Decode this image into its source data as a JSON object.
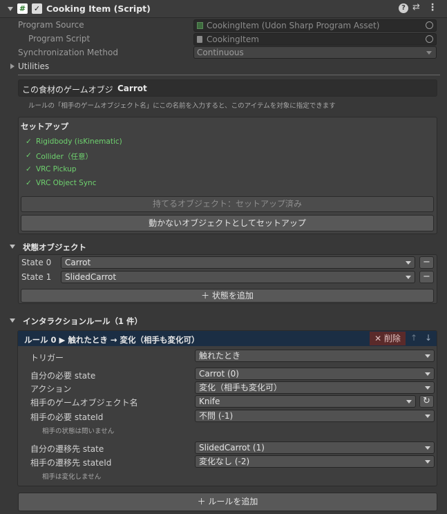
{
  "header": {
    "title": "Cooking Item (Script)",
    "script_icon": "#",
    "help_icon": "?",
    "settings_icon": "⇄",
    "more_icon": "⋮"
  },
  "props": {
    "program_source_label": "Program Source",
    "program_source_value": "CookingItem (Udon Sharp Program Asset)",
    "program_script_label": "Program Script",
    "program_script_value": "CookingItem",
    "sync_label": "Synchronization Method",
    "sync_value": "Continuous",
    "utilities_label": "Utilities"
  },
  "name_box": {
    "prefix": "この食材のゲームオブジ",
    "name": "Carrot",
    "hint": "ルールの「相手のゲームオブジェクト名」にこの名前を入力すると、このアイテムを対象に指定できます"
  },
  "setup": {
    "title": "セットアップ",
    "items": [
      "Rigidbody (isKinematic)",
      "Collider（任意）",
      "VRC Pickup",
      "VRC Object Sync"
    ],
    "check": "✓",
    "status_button": "持てるオブジェクト：セットアップ済み",
    "static_button": "動かないオブジェクトとしてセットアップ"
  },
  "states": {
    "title": "状態オブジェクト",
    "rows": [
      {
        "label": "State 0",
        "value": "Carrot"
      },
      {
        "label": "State 1",
        "value": "SlidedCarrot"
      }
    ],
    "minus": "−",
    "add_button": "＋ 状態を追加"
  },
  "rules": {
    "title": "インタラクションルール（1 件）",
    "rule_header": "ルール 0 ▶ 触れたとき → 変化（相手も変化可）",
    "delete_button": "✕ 削除",
    "up": "↑",
    "down": "↓",
    "trigger_label": "トリガー",
    "trigger_value": "触れたとき",
    "my_state_label": "自分の必要 state",
    "my_state_value": "Carrot (0)",
    "action_label": "アクション",
    "action_value": "変化（相手も変化可）",
    "other_name_label": "相手のゲームオブジェクト名",
    "other_name_value": "Knife",
    "refresh_icon": "↻",
    "other_state_label": "相手の必要 stateId",
    "other_state_value": "不問 (-1)",
    "other_state_hint": "相手の状態は問いません",
    "my_next_label": "自分の遷移先 state",
    "my_next_value": "SlidedCarrot (1)",
    "other_next_label": "相手の遷移先 stateId",
    "other_next_value": "変化なし (-2)",
    "other_next_hint": "相手は変化しません",
    "add_rule_button": "＋ ルールを追加"
  },
  "colors": {
    "background": "#383838",
    "check_green": "#6fd36f",
    "rule_header_bg": "#1b2e44",
    "delete_bg": "#5a2a2a"
  }
}
